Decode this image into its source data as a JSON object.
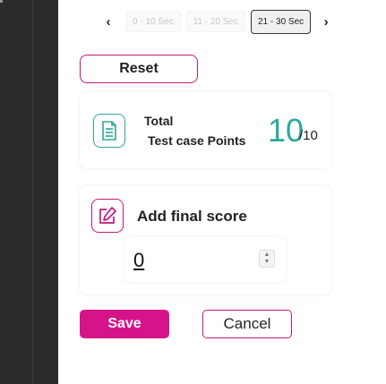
{
  "time_filter": {
    "prev_arrow": "‹",
    "next_arrow": "›",
    "segments": [
      "0 - 10 Sec",
      "11 - 20 Sec",
      "21 - 30 Sec"
    ],
    "active_index": 2
  },
  "reset_button": "Reset",
  "total_card": {
    "line1": "Total",
    "line2": "Test case Points",
    "score": "10",
    "max": "/10",
    "icon": "document-icon"
  },
  "final_card": {
    "label": "Add final score",
    "input_value": "0",
    "icon": "edit-icon"
  },
  "actions": {
    "save": "Save",
    "cancel": "Cancel"
  },
  "colors": {
    "accent": "#d6148a",
    "teal": "#2aa89a",
    "sidebar": "#2b2b2b"
  }
}
